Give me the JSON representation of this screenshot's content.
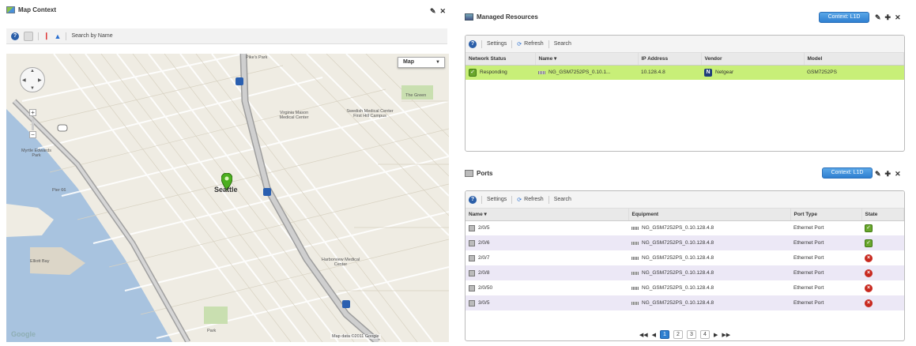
{
  "map_panel": {
    "title": "Map Context",
    "toolbar": {
      "search_label": "Search by Name"
    },
    "map_type": "Map",
    "city_label": "Seattle",
    "labels": {
      "pike_park": "Pike's Park",
      "harrison": "First Hill Park",
      "the_green": "The Green",
      "virginia": "Virginia Mason Medical Center",
      "swedish": "Swedish Medical Center First Hill Campus",
      "myrtle": "Myrtle Edwards Park",
      "harborview": "Harborview Medical Center",
      "park": "Park",
      "pier": "Pier 66",
      "elliott": "Elliott Bay"
    },
    "copyright": "Map data ©2011 Google",
    "google": "Google"
  },
  "managed": {
    "title": "Managed Resources",
    "context_button": "Context: L1D",
    "toolbar": {
      "settings": "Settings",
      "refresh": "Refresh",
      "search": "Search"
    },
    "columns": [
      "Network Status",
      "Name ▾",
      "IP Address",
      "Vendor",
      "Model"
    ],
    "rows": [
      {
        "status": "Responding",
        "name": "NG_GSM7252PS_0.10.1...",
        "ip": "10.128.4.8",
        "vendor": "Netgear",
        "model": "GSM7252PS"
      }
    ]
  },
  "ports": {
    "title": "Ports",
    "context_button": "Context: L1D",
    "toolbar": {
      "settings": "Settings",
      "refresh": "Refresh",
      "search": "Search"
    },
    "columns": [
      "Name ▾",
      "Equipment",
      "Port Type",
      "State"
    ],
    "rows": [
      {
        "name": "2/0/5",
        "equipment": "NG_GSM7252PS_0.10.128.4.8",
        "type": "Ethernet Port",
        "state": "ok"
      },
      {
        "name": "2/0/6",
        "equipment": "NG_GSM7252PS_0.10.128.4.8",
        "type": "Ethernet Port",
        "state": "ok"
      },
      {
        "name": "2/0/7",
        "equipment": "NG_GSM7252PS_0.10.128.4.8",
        "type": "Ethernet Port",
        "state": "err"
      },
      {
        "name": "2/0/8",
        "equipment": "NG_GSM7252PS_0.10.128.4.8",
        "type": "Ethernet Port",
        "state": "err"
      },
      {
        "name": "2/0/50",
        "equipment": "NG_GSM7252PS_0.10.128.4.8",
        "type": "Ethernet Port",
        "state": "err"
      },
      {
        "name": "3/0/5",
        "equipment": "NG_GSM7252PS_0.10.128.4.8",
        "type": "Ethernet Port",
        "state": "err"
      }
    ],
    "pager": [
      "1",
      "2",
      "3",
      "4"
    ]
  },
  "colors": {
    "accent": "#2f7fd0",
    "highlight": "#c8ef78",
    "alt_row": "#ece8f6",
    "ok": "#6aa72d",
    "error": "#c8291f"
  }
}
